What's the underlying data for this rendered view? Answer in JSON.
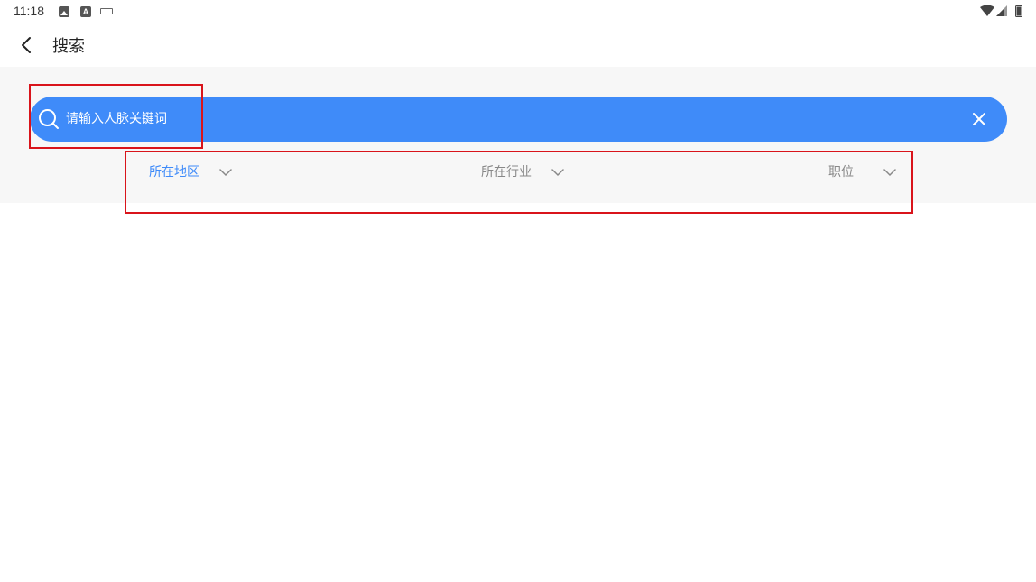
{
  "status_bar": {
    "time": "11:18",
    "icons": [
      "image-icon",
      "a-icon",
      "keyboard-icon",
      "wifi-icon",
      "signal-icon",
      "battery-icon"
    ]
  },
  "header": {
    "title": "搜索",
    "back_icon": "chevron-left-icon"
  },
  "search": {
    "placeholder": "请输入人脉关键词",
    "value": "",
    "icons": [
      "search-icon",
      "close-icon"
    ]
  },
  "filters": [
    {
      "label": "所在地区",
      "active": true
    },
    {
      "label": "所在行业",
      "active": false
    },
    {
      "label": "职位",
      "active": false
    }
  ],
  "colors": {
    "accent": "#3f8bf9",
    "panel_background": "#f7f7f7",
    "inactive_filter": "#888888",
    "annotation_box": "#d9141b"
  }
}
